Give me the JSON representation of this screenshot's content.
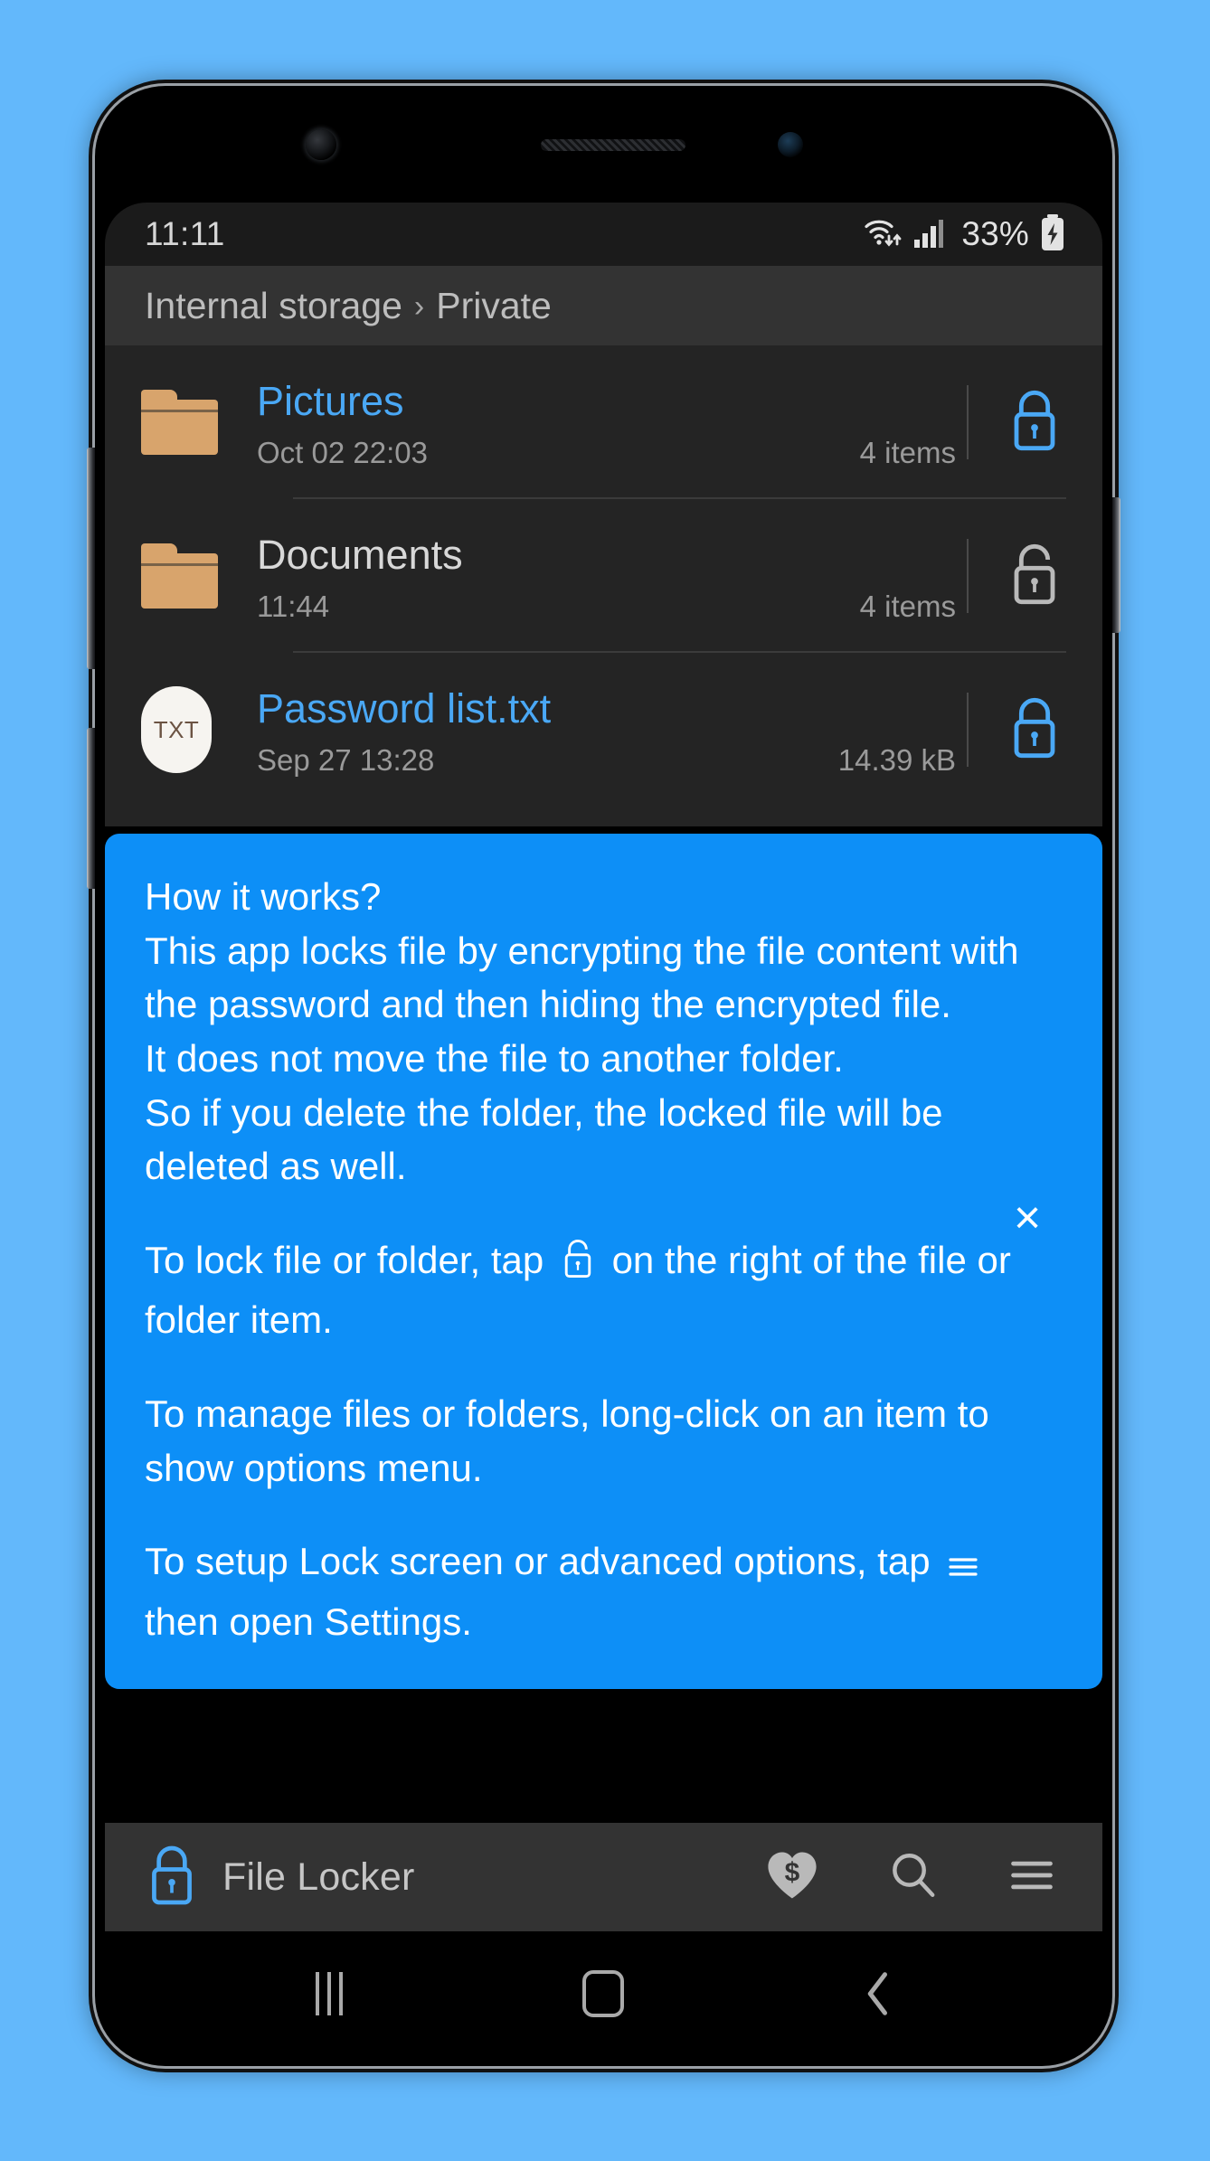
{
  "status_bar": {
    "time": "11:11",
    "battery_percent": "33%",
    "icons": [
      "wifi-data-icon",
      "cellular-signal-icon",
      "battery-charging-icon"
    ]
  },
  "breadcrumb": {
    "root": "Internal storage",
    "separator": "›",
    "current": "Private"
  },
  "file_list": [
    {
      "name": "Pictures",
      "type": "folder",
      "icon": "folder-icon",
      "date": "Oct 02 22:03",
      "size": "4 items",
      "locked": true,
      "lock_icon": "lock-closed-icon",
      "name_color": "#4aa8f5"
    },
    {
      "name": "Documents",
      "type": "folder",
      "icon": "folder-icon",
      "date": "11:44",
      "size": "4 items",
      "locked": false,
      "lock_icon": "lock-open-icon",
      "name_color": "#d8d8d8"
    },
    {
      "name": "Password list.txt",
      "type": "file",
      "icon": "txt-file-icon",
      "icon_label": "TXT",
      "date": "Sep 27 13:28",
      "size": "14.39 kB",
      "locked": true,
      "lock_icon": "lock-closed-icon",
      "name_color": "#4aa8f5"
    }
  ],
  "info_panel": {
    "background_color": "#0d8ff7",
    "close_label": "×",
    "line1": "How it works?",
    "line2": "This app locks file by encrypting the file content with the password and then hiding the encrypted file.",
    "line3": "It does not move the file to another folder.",
    "line4": "So if you delete the folder, the locked file will be deleted as well.",
    "line5_before": "To lock file or folder, tap",
    "line5_icon": "lock-open-icon",
    "line5_after": "on the right of the file or folder item.",
    "line6": "To manage files or folders, long-click on an item to show options menu.",
    "line7_before": "To setup Lock screen or advanced options, tap",
    "line7_icon": "hamburger-menu-icon",
    "line7_after": "then open Settings."
  },
  "app_bar": {
    "app_icon": "lock-closed-icon",
    "title": "File Locker",
    "actions": [
      {
        "name": "donate-heart-dollar-icon"
      },
      {
        "name": "search-icon"
      },
      {
        "name": "hamburger-menu-icon"
      }
    ]
  },
  "nav_bar": {
    "recents": "recents-icon",
    "home": "home-icon",
    "back": "back-icon",
    "back_glyph": "‹"
  },
  "colors": {
    "page_background": "#63b8fb",
    "accent_blue": "#0d8ff7",
    "link_blue": "#4aa8f5",
    "folder_tan": "#d8a46c",
    "list_background": "#242424",
    "bar_background": "#333333"
  }
}
